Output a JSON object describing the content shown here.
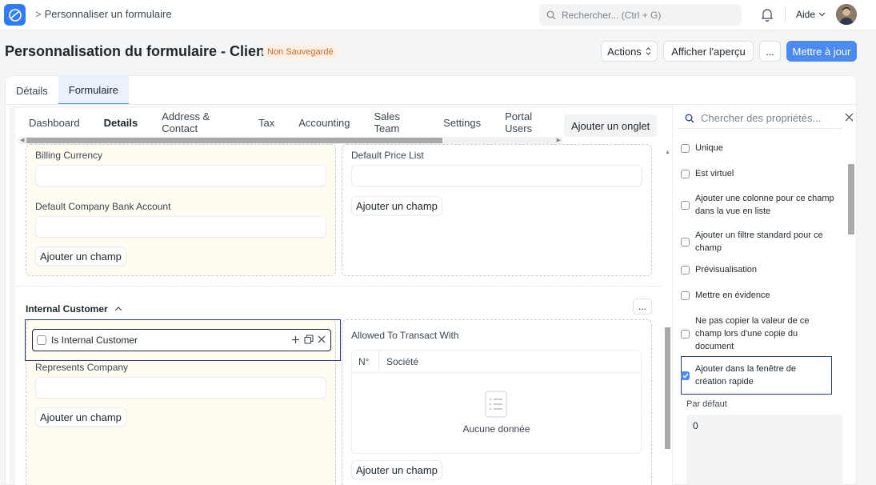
{
  "navbar": {
    "breadcrumb": "Personnaliser un formulaire",
    "search_placeholder": "Rechercher... (Ctrl + G)",
    "help_label": "Aide"
  },
  "header": {
    "title": "Personnalisation du formulaire - Client",
    "status_badge": "Non Sauvegardé",
    "actions_label": "Actions",
    "preview_label": "Afficher l'aperçu",
    "more_label": "...",
    "update_label": "Mettre à jour"
  },
  "top_tabs": [
    {
      "label": "Détails",
      "active": false
    },
    {
      "label": "Formulaire",
      "active": true
    }
  ],
  "form_tabs": [
    {
      "label": "Dashboard",
      "active": false
    },
    {
      "label": "Details",
      "active": true
    },
    {
      "label": "Address & Contact",
      "active": false
    },
    {
      "label": "Tax",
      "active": false
    },
    {
      "label": "Accounting",
      "active": false
    },
    {
      "label": "Sales Team",
      "active": false
    },
    {
      "label": "Settings",
      "active": false
    },
    {
      "label": "Portal Users",
      "active": false
    }
  ],
  "add_tab_label": "Ajouter un onglet",
  "add_field_label": "Ajouter un champ",
  "section1": {
    "left_fields": [
      "Billing Currency",
      "Default Company Bank Account"
    ],
    "right_fields": [
      "Default Price List"
    ]
  },
  "section2": {
    "title": "Internal Customer",
    "more_label": "...",
    "selected_field": "Is Internal Customer",
    "left_fields": [
      "Represents Company"
    ],
    "right_field_label": "Allowed To Transact With",
    "table": {
      "columns": [
        "N°",
        "Société"
      ],
      "empty_text": "Aucune donnée"
    }
  },
  "properties": {
    "search_placeholder": "Chercher des propriétés...",
    "items": [
      {
        "label": "Unique",
        "checked": false
      },
      {
        "label": "Est virtuel",
        "checked": false
      },
      {
        "label": "Ajouter une colonne pour ce champ dans la vue en liste",
        "checked": false
      },
      {
        "label": "Ajouter un filtre standard pour ce champ",
        "checked": false
      },
      {
        "label": "Prévisualisation",
        "checked": false
      },
      {
        "label": "Mettre en évidence",
        "checked": false
      },
      {
        "label": "Ne pas copier la valeur de ce champ lors d'une copie du document",
        "checked": false
      },
      {
        "label": "Ajouter dans la fenêtre de création rapide",
        "checked": true
      }
    ],
    "default_label": "Par défaut",
    "default_value": "0"
  },
  "colors": {
    "accent": "#4d8af0",
    "badge_text": "#c96a20",
    "badge_bg": "#fff0e6",
    "column_yellow": "#fffcf2"
  }
}
